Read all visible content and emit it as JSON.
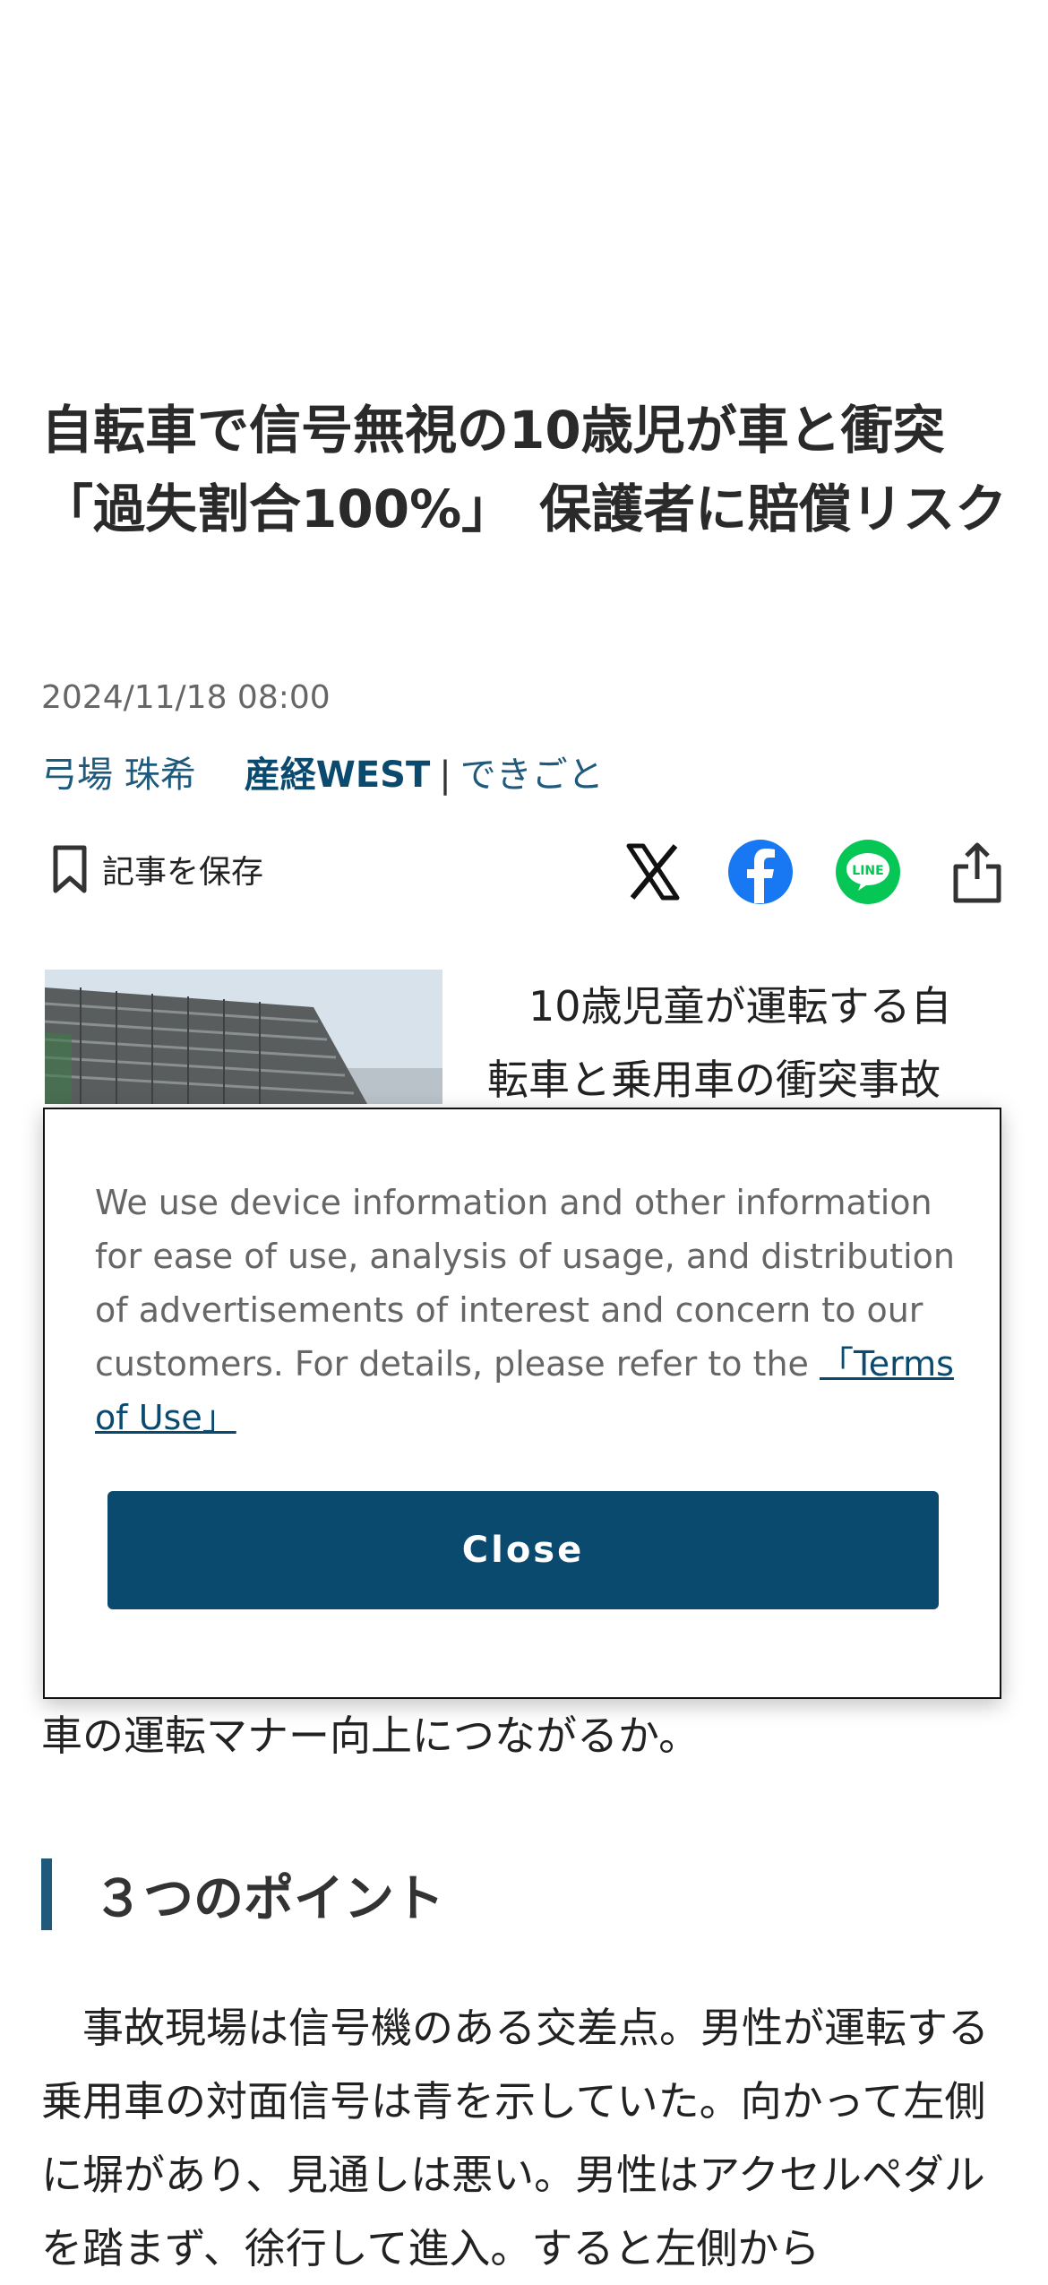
{
  "article": {
    "headline": "自転車で信号無視の10歳児が車と衝突「過失割合100%」　保護者に賠償リスク",
    "datetime": "2024/11/18 08:00",
    "author": "弓場 珠希",
    "source": "産経WEST",
    "separator": "|",
    "category": "できごと",
    "lead": "　10歳児童が運転する自転車と乗用車の衝突事故",
    "continued_line": "車の運転マナー向上につながるか。",
    "section_title": "３つのポイント",
    "body": "　事故現場は信号機のある交差点。男性が運転する乗用車の対面信号は青を示していた。向かって左側に塀があり、見通しは悪い。男性はアクセルペダルを踏まず、徐行して進入。すると左側から"
  },
  "actions": {
    "save_label": "記事を保存",
    "share_icons": [
      "x-icon",
      "facebook-icon",
      "line-icon",
      "share-icon"
    ]
  },
  "cookie_notice": {
    "text": "We use device information and other information for ease of use, analysis of usage, and distribution of advertisements of interest and concern to our customers. For details, please refer to the ",
    "link_label": "「Terms of Use」",
    "close_label": "Close"
  },
  "colors": {
    "brand": "#0b4a6f",
    "link": "#1f5a7d",
    "facebook": "#1877f2",
    "line": "#06c755"
  }
}
